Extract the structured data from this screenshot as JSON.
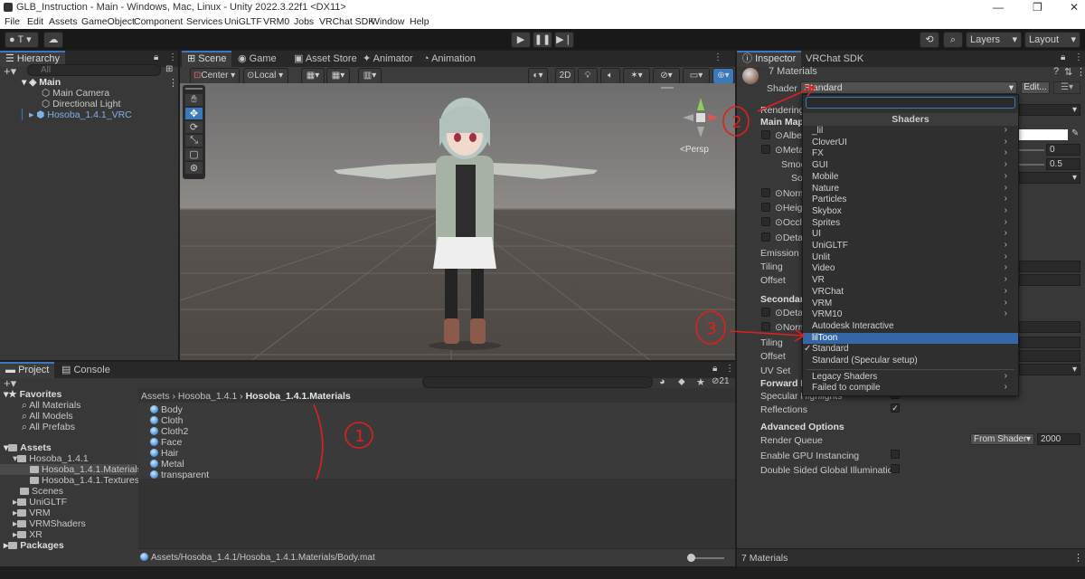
{
  "window": {
    "title": "GLB_Instruction - Main - Windows, Mac, Linux - Unity 2022.3.22f1 <DX11>",
    "minimize": "—",
    "maximize": "❐",
    "close": "✕"
  },
  "menu": [
    "File",
    "Edit",
    "Assets",
    "GameObject",
    "Component",
    "Services",
    "UniGLTF",
    "VRM0",
    "Jobs",
    "VRChat SDK",
    "Window",
    "Help"
  ],
  "toolbar": {
    "account": "T",
    "layers": "Layers",
    "layout": "Layout"
  },
  "hierarchy": {
    "tab": "Hierarchy",
    "search_placeholder": "All",
    "scene": "Main",
    "items": [
      "Main Camera",
      "Directional Light",
      "Hosoba_1.4.1_VRC"
    ]
  },
  "scene_view": {
    "tabs": [
      "Scene",
      "Game",
      "Asset Store",
      "Animator",
      "Animation"
    ],
    "pivot": "Center",
    "space": "Local",
    "mode_2d": "2D",
    "persp": "<Persp"
  },
  "project": {
    "tabs": [
      "Project",
      "Console"
    ],
    "count": "21",
    "favorites_label": "Favorites",
    "favorites": [
      "All Materials",
      "All Models",
      "All Prefabs"
    ],
    "assets_label": "Assets",
    "tree": [
      "Hosoba_1.4.1",
      "Hosoba_1.4.1.Materials",
      "Hosoba_1.4.1.Textures",
      "Scenes",
      "UniGLTF",
      "VRM",
      "VRMShaders",
      "XR"
    ],
    "packages_label": "Packages",
    "breadcrumb": [
      "Assets",
      "Hosoba_1.4.1",
      "Hosoba_1.4.1.Materials"
    ],
    "materials": [
      "Body",
      "Cloth",
      "Cloth2",
      "Face",
      "Hair",
      "Metal",
      "transparent"
    ],
    "footer_path": "Assets/Hosoba_1.4.1/Hosoba_1.4.1.Materials/Body.mat"
  },
  "inspector": {
    "tabs": [
      "Inspector",
      "VRChat SDK"
    ],
    "header": "7 Materials",
    "shader_label": "Shader",
    "shader_value": "Standard",
    "edit_button": "Edit...",
    "labels": {
      "rendering": "Rendering",
      "main_maps": "Main Maps",
      "albedo": "Albec",
      "metallic": "Meta",
      "smoothness": "Smoo",
      "source": "So",
      "normal": "Norm",
      "height": "Heigh",
      "occlusion": "Occlu",
      "detail": "Detai",
      "emission": "Emission",
      "tiling": "Tiling",
      "offset": "Offset",
      "secondary": "Secondary",
      "detail2": "Detai",
      "normal2": "Norm",
      "tiling2": "Tiling",
      "offset2": "Offset",
      "uvset": "UV Set",
      "forward": "Forward R",
      "specular": "Specular Highlights",
      "reflections": "Reflections",
      "advanced": "Advanced Options",
      "render_queue": "Render Queue",
      "gpu": "Enable GPU Instancing",
      "double_sided": "Double Sided Global Illumination"
    },
    "metallic_value": "0",
    "smoothness_value": "0.5",
    "render_queue_mode": "From Shader",
    "render_queue_value": "2000",
    "footer": "7 Materials"
  },
  "shader_menu": {
    "search_value": "",
    "header": "Shaders",
    "items": [
      {
        "label": "_lil",
        "submenu": true
      },
      {
        "label": "CloverUI",
        "submenu": true
      },
      {
        "label": "FX",
        "submenu": true
      },
      {
        "label": "GUI",
        "submenu": true
      },
      {
        "label": "Mobile",
        "submenu": true
      },
      {
        "label": "Nature",
        "submenu": true
      },
      {
        "label": "Particles",
        "submenu": true
      },
      {
        "label": "Skybox",
        "submenu": true
      },
      {
        "label": "Sprites",
        "submenu": true
      },
      {
        "label": "UI",
        "submenu": true
      },
      {
        "label": "UniGLTF",
        "submenu": true
      },
      {
        "label": "Unlit",
        "submenu": true
      },
      {
        "label": "Video",
        "submenu": true
      },
      {
        "label": "VR",
        "submenu": true
      },
      {
        "label": "VRChat",
        "submenu": true
      },
      {
        "label": "VRM",
        "submenu": true
      },
      {
        "label": "VRM10",
        "submenu": true
      },
      {
        "label": "Autodesk Interactive",
        "submenu": false
      },
      {
        "label": "lilToon",
        "submenu": false,
        "selected": true
      },
      {
        "label": "Standard",
        "submenu": false,
        "checked": true
      },
      {
        "label": "Standard (Specular setup)",
        "submenu": false
      },
      {
        "label": "Legacy Shaders",
        "submenu": true
      },
      {
        "label": "Failed to compile",
        "submenu": true
      }
    ],
    "checkmark": "✓",
    "arrow": "›"
  },
  "annotations": [
    "1",
    "2",
    "3"
  ],
  "colors": {
    "accent": "#3a79bb",
    "selection": "#3566a6",
    "annotation": "#e0201e"
  }
}
